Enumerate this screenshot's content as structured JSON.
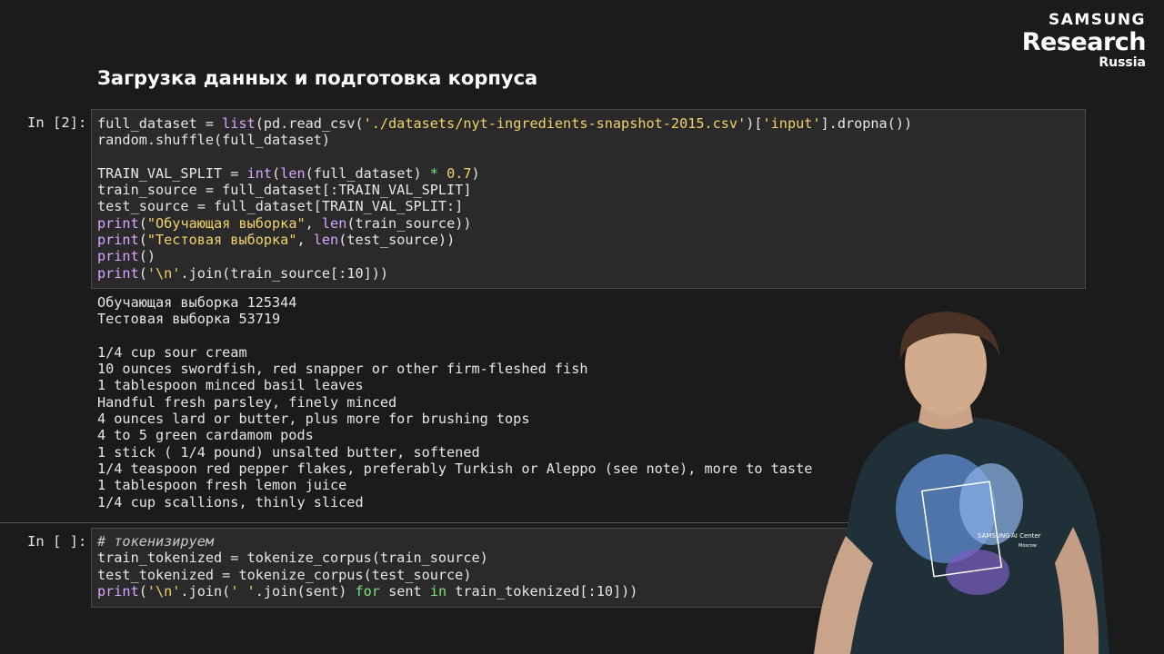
{
  "logo": {
    "line1": "SAMSUNG",
    "line2": "Research",
    "line3": "Russia"
  },
  "slide_title": "Загрузка данных и подготовка корпуса",
  "cell1": {
    "prompt": "In [2]:",
    "code": [
      "full_dataset = list(pd.read_csv('./datasets/nyt-ingredients-snapshot-2015.csv')['input'].dropna())",
      "random.shuffle(full_dataset)",
      "",
      "TRAIN_VAL_SPLIT = int(len(full_dataset) * 0.7)",
      "train_source = full_dataset[:TRAIN_VAL_SPLIT]",
      "test_source = full_dataset[TRAIN_VAL_SPLIT:]",
      "print(\"Обучающая выборка\", len(train_source))",
      "print(\"Тестовая выборка\", len(test_source))",
      "print()",
      "print('\\n'.join(train_source[:10]))"
    ],
    "output": [
      "Обучающая выборка 125344",
      "Тестовая выборка 53719",
      "",
      "1/4 cup sour cream",
      "10 ounces swordfish, red snapper or other firm-fleshed fish",
      "1 tablespoon minced basil leaves",
      "Handful fresh parsley, finely minced",
      "4 ounces lard or butter, plus more for brushing tops",
      "4 to 5 green cardamom pods",
      "1 stick ( 1/4 pound) unsalted butter, softened",
      "1/4 teaspoon red pepper flakes, preferably Turkish or Aleppo (see note), more to taste",
      "1 tablespoon fresh lemon juice",
      "1/4 cup scallions, thinly sliced"
    ]
  },
  "cell2": {
    "prompt": "In [ ]:",
    "code": [
      "# токенизируем",
      "train_tokenized = tokenize_corpus(train_source)",
      "test_tokenized = tokenize_corpus(test_source)",
      "print('\\n'.join(' '.join(sent) for sent in train_tokenized[:10]))"
    ]
  },
  "shirt_text": {
    "brand": "SAMSUNG",
    "center": "AI Center",
    "city": "Moscow"
  },
  "colors": {
    "background": "#1b1b1b",
    "cell_bg": "#2a2a2a",
    "keyword": "#7ee07e",
    "builtin": "#d8a6ff",
    "string": "#f2d26b"
  }
}
